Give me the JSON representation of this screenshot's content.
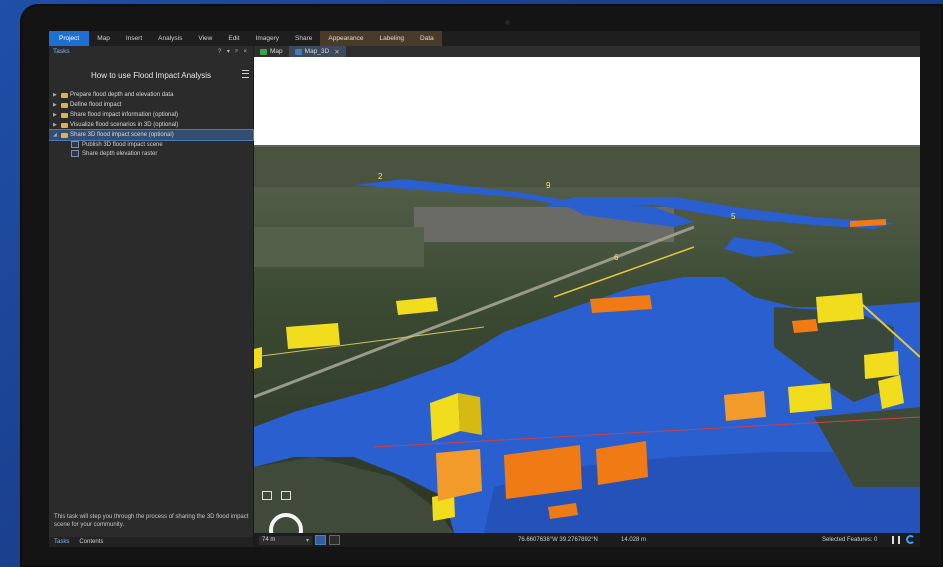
{
  "ribbon": {
    "tabs": [
      {
        "label": "Project"
      },
      {
        "label": "Map"
      },
      {
        "label": "Insert"
      },
      {
        "label": "Analysis"
      },
      {
        "label": "View"
      },
      {
        "label": "Edit"
      },
      {
        "label": "Imagery"
      },
      {
        "label": "Share"
      },
      {
        "label": "Appearance"
      },
      {
        "label": "Labeling"
      },
      {
        "label": "Data"
      }
    ]
  },
  "tasks_pane": {
    "title": "Tasks",
    "controls": "? ▾ ᵖ ×",
    "task_name": "How to use Flood Impact Analysis",
    "items": [
      {
        "label": "Prepare flood depth and elevation data"
      },
      {
        "label": "Define flood impact"
      },
      {
        "label": "Share flood impact information (optional)"
      },
      {
        "label": "Visualize flood scenarios in 3D (optional)"
      },
      {
        "label": "Share 3D flood impact scene (optional)"
      }
    ],
    "subitems": [
      {
        "label": "Publish 3D flood impact scene"
      },
      {
        "label": "Share depth elevation raster"
      }
    ],
    "description": "This task will step you through the process of sharing the 3D flood impact scene for your community.",
    "bottom_tabs": [
      {
        "label": "Tasks"
      },
      {
        "label": "Contents"
      }
    ]
  },
  "view_tabs": [
    {
      "label": "Map"
    },
    {
      "label": "Map_3D"
    }
  ],
  "scene_labels": [
    {
      "text": "2"
    },
    {
      "text": "9"
    },
    {
      "text": "5"
    },
    {
      "text": "6"
    }
  ],
  "status_bar": {
    "scale": "74 m",
    "coordinates": "76.6607638°W 39.2767892°N",
    "distance": "14.028 m",
    "selected_features": "Selected Features: 0"
  },
  "colors": {
    "ribbon_active": "#1f6fd1",
    "flood_water": "#2a5fd0",
    "building_yellow": "#f2dc1e",
    "building_orange": "#f07a14"
  }
}
